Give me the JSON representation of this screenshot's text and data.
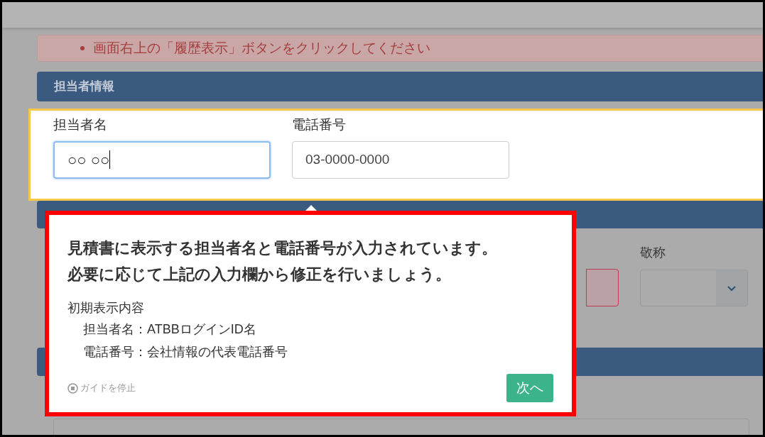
{
  "alert": {
    "message": "画面右上の「履歴表示」ボタンをクリックしてください"
  },
  "staff_section": {
    "title": "担当者情報",
    "fields": [
      {
        "label": "担当者名",
        "value": "○○ ○○",
        "focused": true
      },
      {
        "label": "電話番号",
        "value": "03-0000-0000",
        "focused": false
      }
    ]
  },
  "customer_section": {
    "honorific_label": "敬称"
  },
  "guide": {
    "heading_lines": [
      "見積書に表示する担当者名と電話番号が入力されています。",
      "必要に応じて上記の入力欄から修正を行いましょう。"
    ],
    "details": {
      "title": "初期表示内容",
      "items": [
        "担当者名：ATBBログインID名",
        "電話番号：会社情報の代表電話番号"
      ]
    },
    "stop_label": "ガイドを停止",
    "next_button": "次へ"
  }
}
